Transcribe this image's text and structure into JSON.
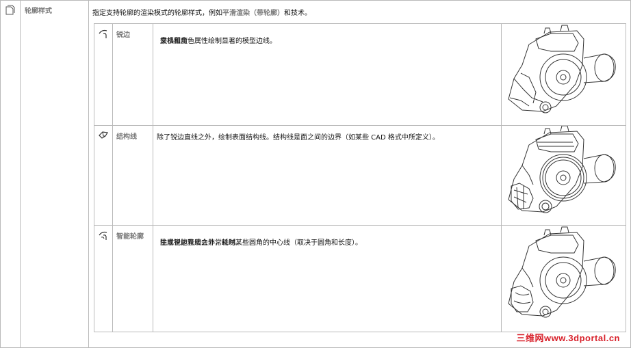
{
  "main": {
    "icon": "page-icon",
    "name": "轮廓样式",
    "description_prefix": "指定支持轮廓的渲染模式的轮廓样式，例如",
    "description_highlight": "平滑渲染（带轮廓）",
    "description_suffix": "和技术。"
  },
  "rows": [
    {
      "icon": "crease-edge-icon",
      "name": "锐边",
      "desc_prefix": "仅根据",
      "desc_highlight": "最小角度",
      "desc_suffix": "文档和角色属性绘制显著的模型边线。",
      "image": "engine-outline-sharp"
    },
    {
      "icon": "structure-line-icon",
      "name": "结构线",
      "desc_text": "除了锐边直线之外，绘制表面结构线。结构线是面之间的边界（如某些 CAD 格式中所定义）。",
      "image": "engine-outline-structure"
    },
    {
      "icon": "smart-outline-icon",
      "name": "智能轮廓",
      "desc_text": "除了锐边直线之外，绘制某些圆角的中心线（取决于圆角和长度）。",
      "note_label": "注意：",
      "note_text": "生成智能轮廓会非常耗时。",
      "image": "engine-outline-smart"
    }
  ],
  "watermark": {
    "cn": "三维网",
    "url": "www.3dportal.cn"
  },
  "colors": {
    "border": "#b9b9b9",
    "label": "#7a7a7a",
    "watermark": "#d8202a"
  }
}
